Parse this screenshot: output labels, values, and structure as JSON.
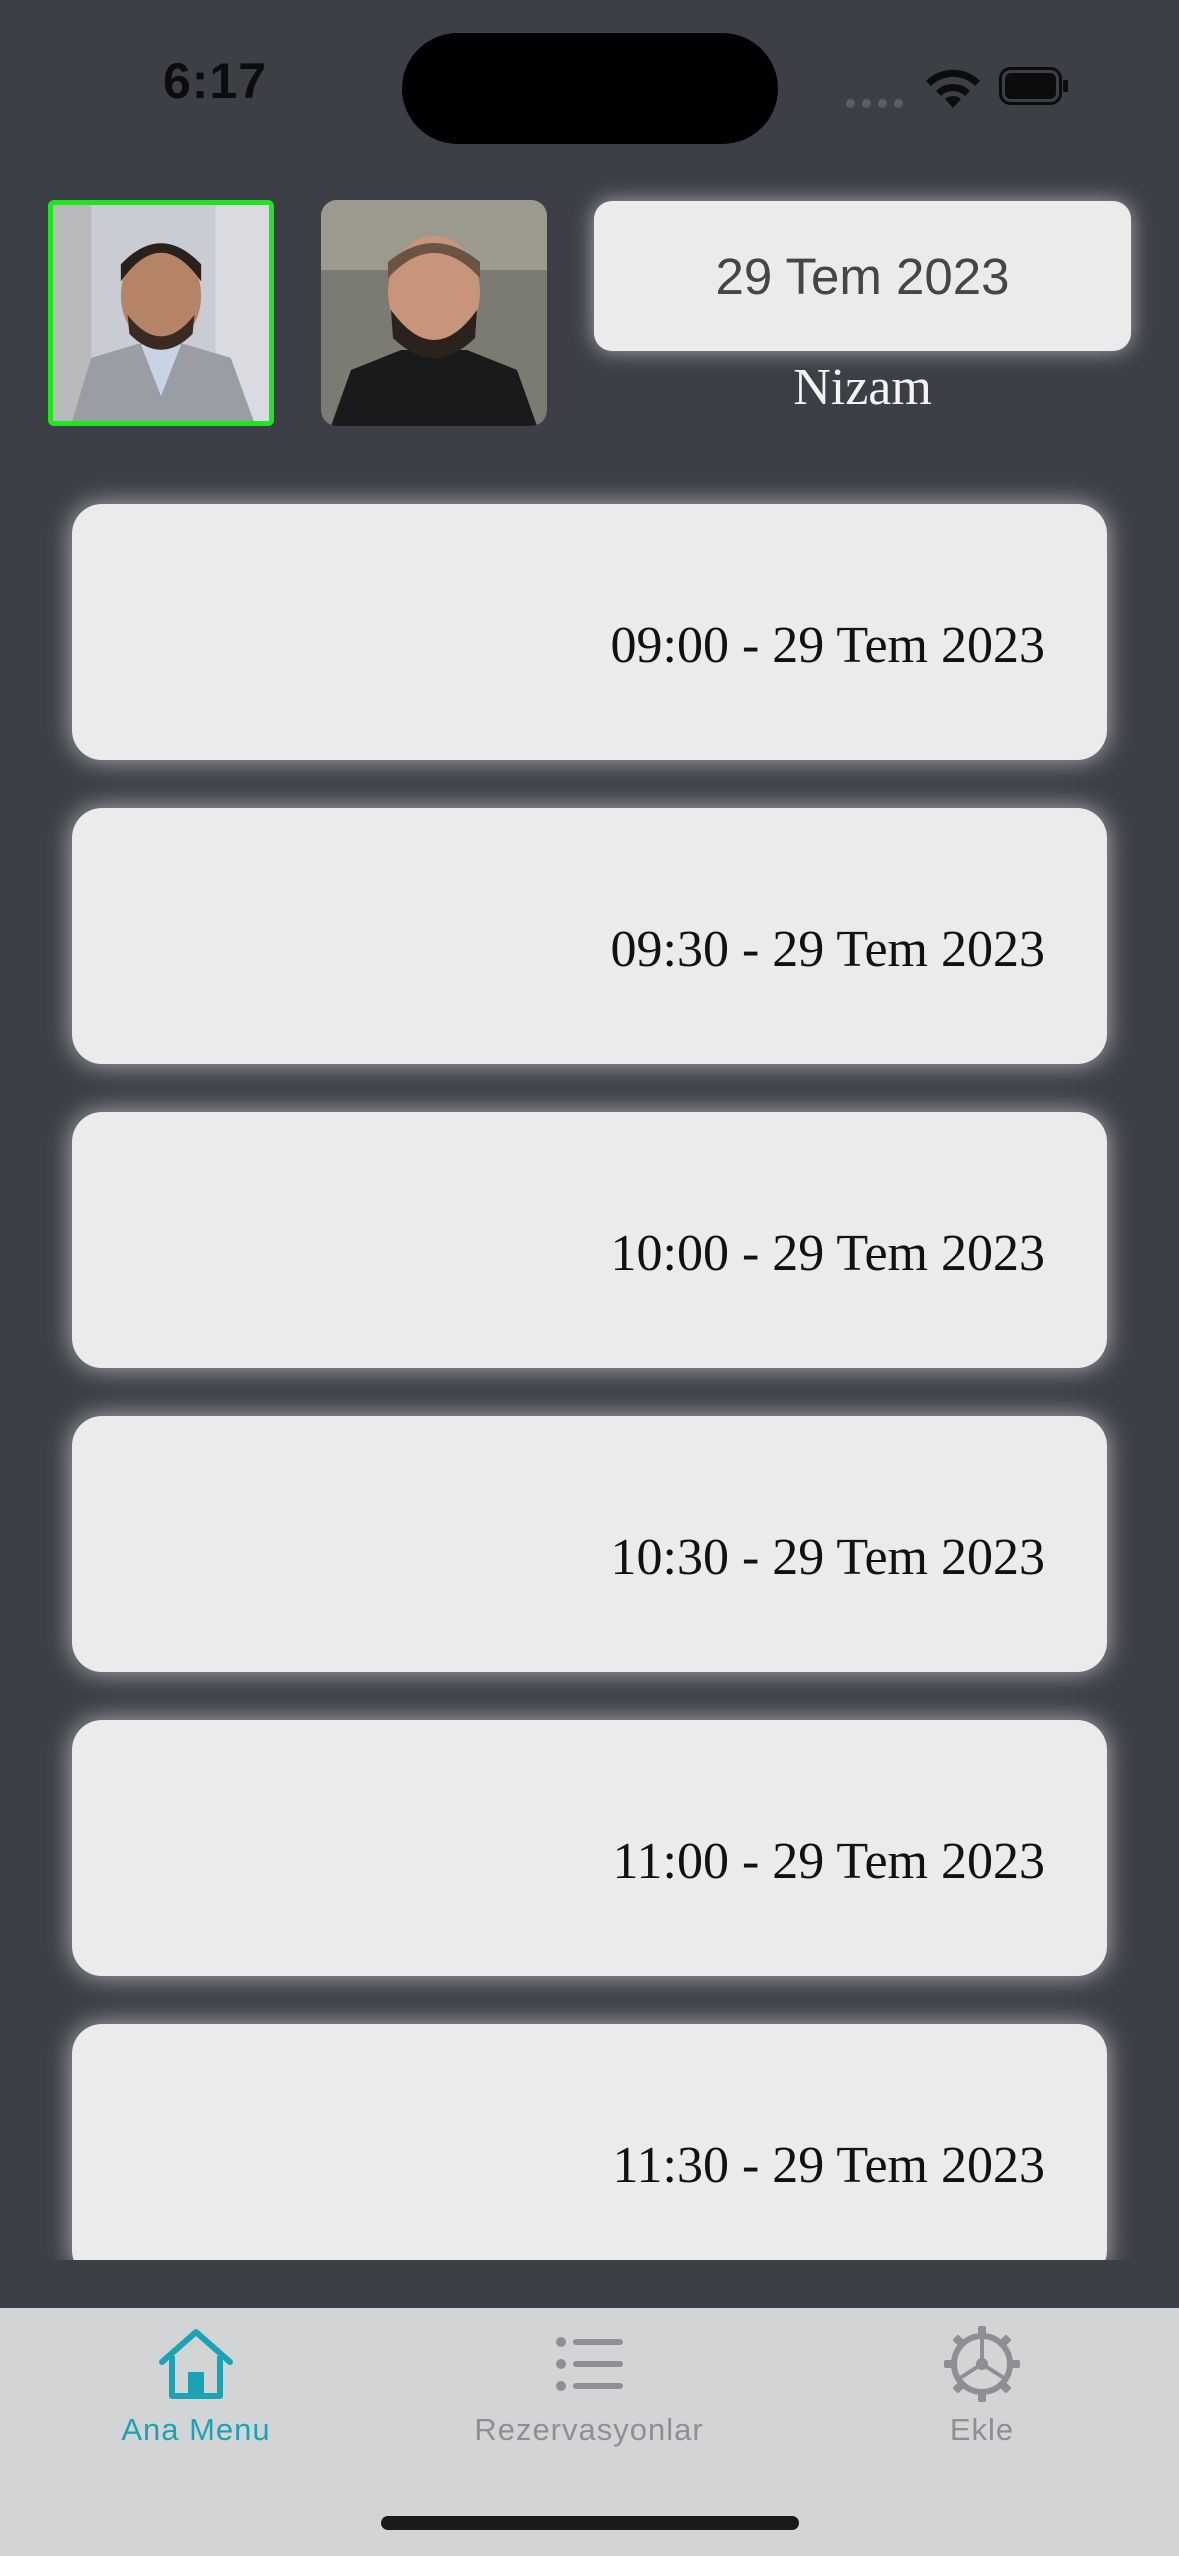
{
  "status_bar": {
    "time": "6:17"
  },
  "header": {
    "barbers": [
      {
        "name": "barber-1",
        "selected": true
      },
      {
        "name": "barber-2",
        "selected": false
      }
    ],
    "date": "29 Tem 2023",
    "selected_barber_name": "Nizam"
  },
  "slots": [
    {
      "label": "09:00 - 29 Tem 2023"
    },
    {
      "label": "09:30 - 29 Tem 2023"
    },
    {
      "label": "10:00 - 29 Tem 2023"
    },
    {
      "label": "10:30 - 29 Tem 2023"
    },
    {
      "label": "11:00 - 29 Tem 2023"
    },
    {
      "label": "11:30 - 29 Tem 2023"
    }
  ],
  "tabbar": {
    "tabs": [
      {
        "label": "Ana Menu",
        "icon": "home-icon",
        "active": true
      },
      {
        "label": "Rezervasyonlar",
        "icon": "list-icon",
        "active": false
      },
      {
        "label": "Ekle",
        "icon": "gear-icon",
        "active": false
      }
    ],
    "active_color": "#1aa3b5",
    "inactive_color": "#8e8f92"
  }
}
